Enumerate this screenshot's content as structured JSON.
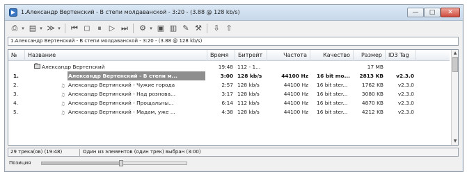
{
  "window": {
    "title": "1.Александр Вертенский - В степи молдаванской - 3:20 - (3.88 @ 128 kb/s)",
    "min_glyph": "—",
    "max_glyph": "□",
    "close_glyph": "✕"
  },
  "toolbar": {
    "icons": [
      "print-icon",
      "dropdown-arrow-icon",
      "playlist-icon",
      "dropdown-arrow-icon",
      "effects-icon",
      "dropdown-arrow-icon",
      "prev-icon",
      "stop-icon",
      "pause-icon",
      "play-icon",
      "next-icon",
      "settings-icon",
      "dropdown-arrow-icon",
      "folder-icon",
      "library-icon",
      "edit-icon",
      "tools-icon",
      "sort-desc-icon",
      "sort-asc-icon"
    ]
  },
  "infobar": {
    "text": "1.Александр Вертенский - В степи молдаванской - 3:20 - (3.88 @ 128 kb/s)"
  },
  "columns": [
    {
      "key": "no",
      "label": "№"
    },
    {
      "key": "title",
      "label": "Название"
    },
    {
      "key": "time",
      "label": "Время"
    },
    {
      "key": "bitrate",
      "label": "Битрейт"
    },
    {
      "key": "freq",
      "label": "Частота"
    },
    {
      "key": "quality",
      "label": "Качество"
    },
    {
      "key": "size",
      "label": "Размер"
    },
    {
      "key": "tag",
      "label": "ID3 Tag"
    }
  ],
  "album_row": {
    "title": "Александр Вертенский",
    "time": "19:48",
    "bitrate": "112 - 1...",
    "size": "17 MB"
  },
  "tracks": [
    {
      "no": "1.",
      "title": "Александр Вертенский - В степи м...",
      "time": "3:00",
      "bitrate": "128 kb/s",
      "freq": "44100 Hz",
      "quality": "16 bit mo...",
      "size": "2813 KB",
      "tag": "v2.3.0",
      "selected": true
    },
    {
      "no": "2.",
      "title": "Александр Вертинский - Чужие города",
      "time": "2:57",
      "bitrate": "128 kb/s",
      "freq": "44100 Hz",
      "quality": "16 bit ster...",
      "size": "1762 KB",
      "tag": "v2.3.0",
      "selected": false
    },
    {
      "no": "3.",
      "title": "Александр Вертинский - Над рознова...",
      "time": "3:17",
      "bitrate": "128 kb/s",
      "freq": "44100 Hz",
      "quality": "16 bit ster...",
      "size": "3080 KB",
      "tag": "v2.3.0",
      "selected": false
    },
    {
      "no": "4.",
      "title": "Александр Вертинский - Прощальны...",
      "time": "6:14",
      "bitrate": "112 kb/s",
      "freq": "44100 Hz",
      "quality": "16 bit ster...",
      "size": "4870 KB",
      "tag": "v2.3.0",
      "selected": false
    },
    {
      "no": "5.",
      "title": "Александр Вертинский - Мадам, уже ...",
      "time": "4:38",
      "bitrate": "128 kb/s",
      "freq": "44100 Hz",
      "quality": "16 bit ster...",
      "size": "4212 KB",
      "tag": "v2.3.0",
      "selected": false
    }
  ],
  "status": {
    "left": "29 трека(ов) (19:48)",
    "right": "Один из элементов (один трек) выбран (3:00)"
  },
  "position": {
    "label": "Позиция",
    "progress": 0.55
  }
}
